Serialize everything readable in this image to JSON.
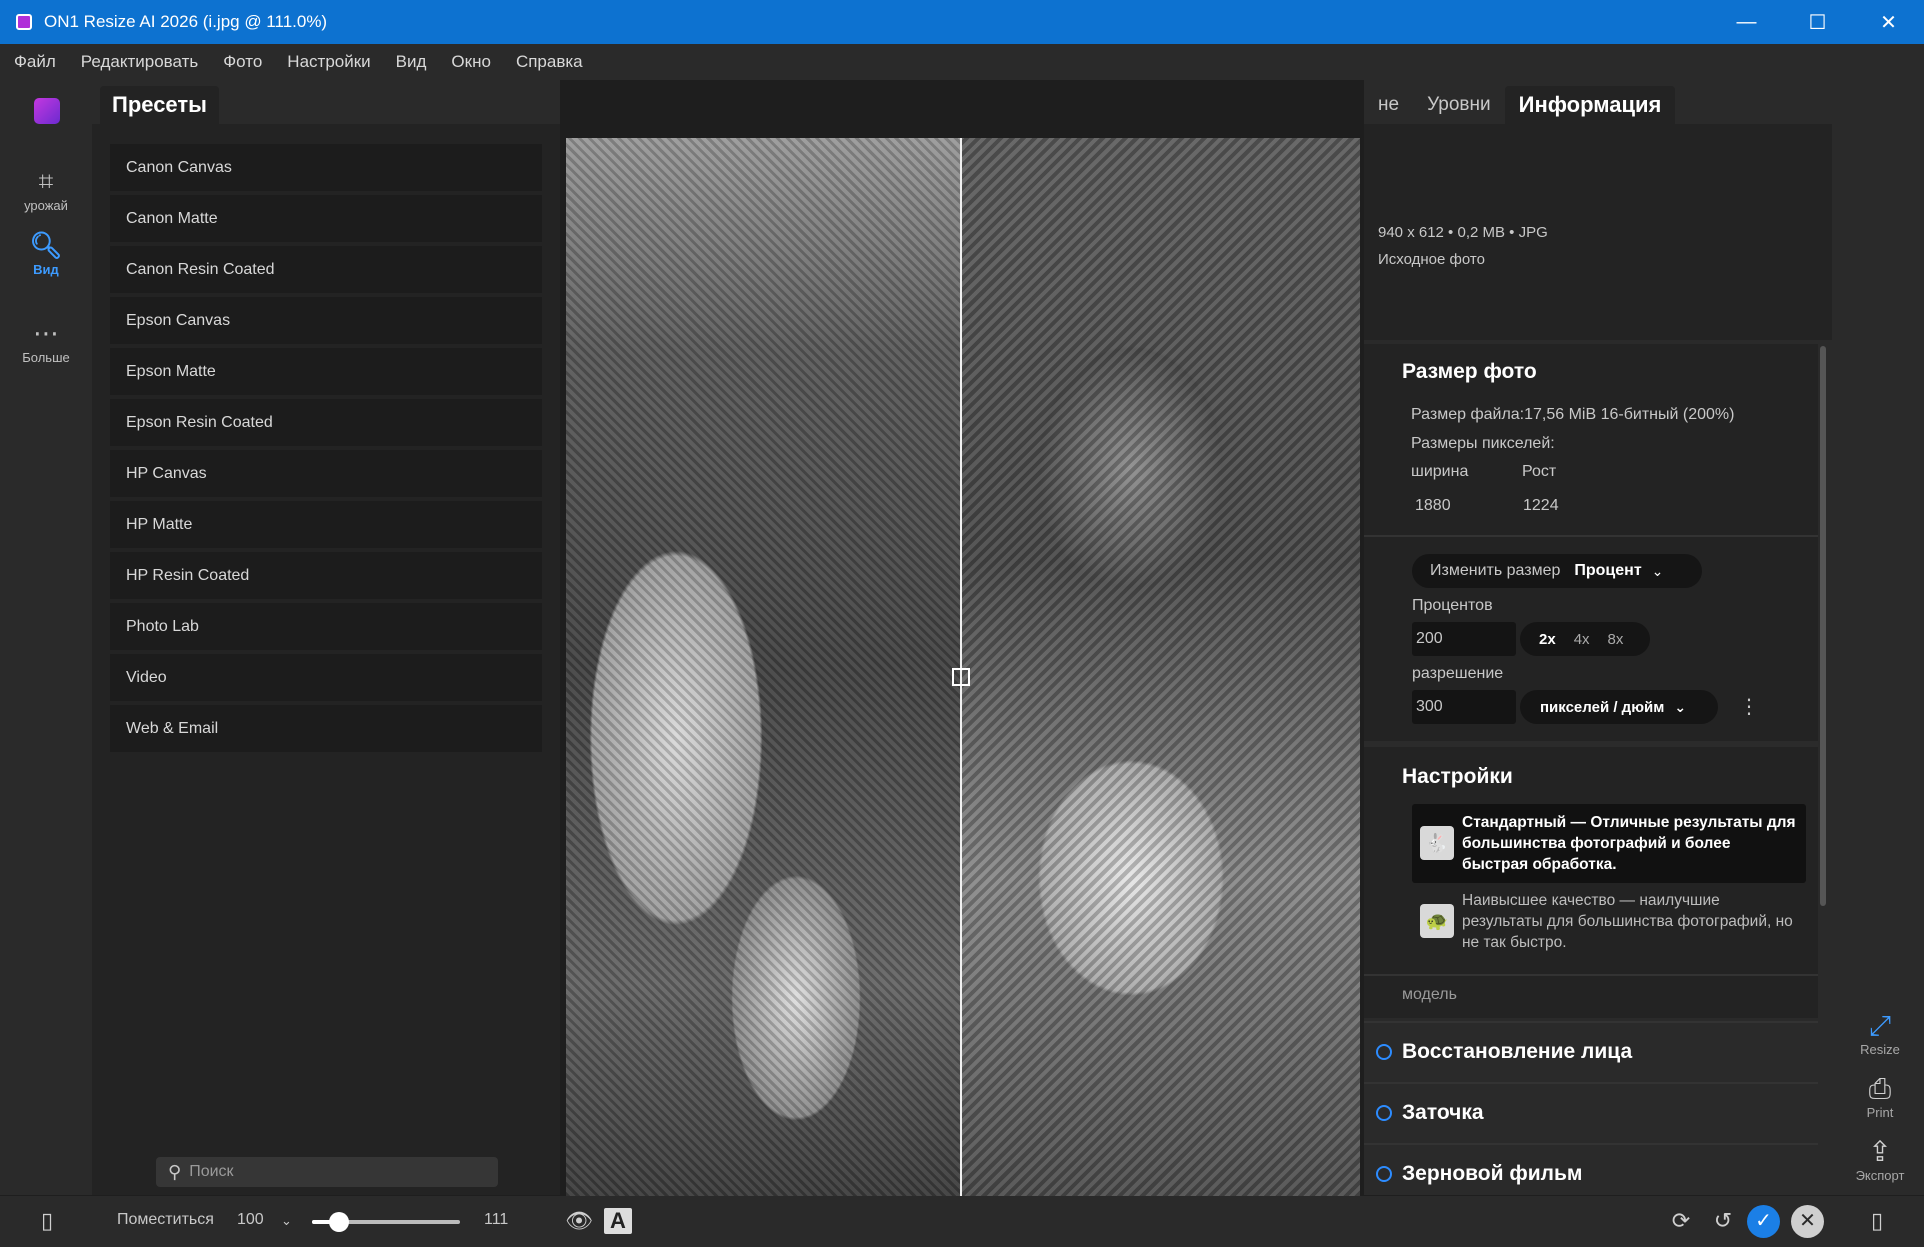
{
  "window": {
    "title": "ON1 Resize AI 2026 (i.jpg @ 111.0%)",
    "minimize": "—",
    "maximize": "☐",
    "close": "✕"
  },
  "menu": [
    "Файл",
    "Редактировать",
    "Фото",
    "Настройки",
    "Вид",
    "Окно",
    "Справка"
  ],
  "toolrail": {
    "crop_label": "урожай",
    "view_label": "Вид",
    "more_label": "Больше"
  },
  "presets": {
    "tab_label": "Пресеты",
    "items": [
      "Canon Canvas",
      "Canon Matte",
      "Canon Resin Coated",
      "Epson Canvas",
      "Epson Matte",
      "Epson Resin Coated",
      "HP Canvas",
      "HP Matte",
      "HP Resin Coated",
      "Photo Lab",
      "Video",
      "Web & Email"
    ],
    "search_placeholder": "Поиск"
  },
  "right_tabs": [
    "не",
    "Уровни",
    "Информация"
  ],
  "info": {
    "dimensions": "940 x 612 • 0,2 MB • JPG",
    "source": "Исходное фото"
  },
  "photo_size": {
    "title": "Размер фото",
    "file_size": "Размер файла:17,56 MiB 16-битный (200%)",
    "pixel_dims_label": "Размеры пикселей:",
    "width_label": "ширина",
    "height_label": "Рост",
    "width_value": "1880",
    "height_value": "1224",
    "resize_label": "Изменить размер",
    "resize_mode": "Процент",
    "percent_label": "Процентов",
    "percent_value": "200",
    "multipliers": [
      "2x",
      "4x",
      "8x"
    ],
    "resolution_label": "разрешение",
    "resolution_value": "300",
    "resolution_unit": "пикселей / дюйм"
  },
  "settings": {
    "title": "Настройки",
    "standard": "Стандартный — Отличные результаты для большинства фотографий и более быстрая обработка.",
    "highest": "Наивысшее качество — наилучшие результаты для большинства фотографий, но не так быстро.",
    "model_label": "модель"
  },
  "accordions": [
    "Восстановление лица",
    "Заточка",
    "Зерновой фильм"
  ],
  "side_rail": {
    "resize": "Resize",
    "print": "Print",
    "export": "Экспорт"
  },
  "bottom": {
    "fit_label": "Поместиться",
    "zoom_preset": "100",
    "zoom_value": "111",
    "zoom_fraction": 0.18
  },
  "colors": {
    "accent": "#0d72d0",
    "highlight": "#3d9bff",
    "confirm": "#1b7fe6"
  }
}
